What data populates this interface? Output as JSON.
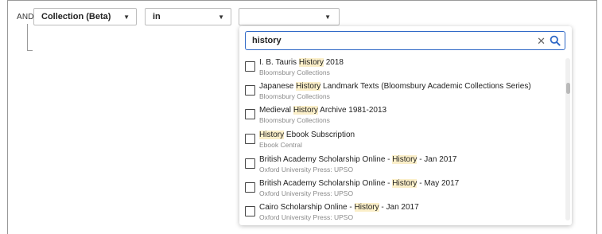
{
  "filter": {
    "conjunction": "AND",
    "field_select": "Collection (Beta)",
    "operator_select": "in",
    "value_select": ""
  },
  "search": {
    "value": "history"
  },
  "options": [
    {
      "pre": "I. B. Tauris ",
      "match": "History",
      "post": " 2018",
      "sub": "Bloomsbury Collections"
    },
    {
      "pre": "Japanese ",
      "match": "History",
      "post": " Landmark Texts (Bloomsbury Academic Collections Series)",
      "sub": "Bloomsbury Collections"
    },
    {
      "pre": "Medieval ",
      "match": "History",
      "post": " Archive 1981-2013",
      "sub": "Bloomsbury Collections"
    },
    {
      "pre": "",
      "match": "History",
      "post": " Ebook Subscription",
      "sub": "Ebook Central"
    },
    {
      "pre": "British Academy Scholarship Online - ",
      "match": "History",
      "post": " - Jan 2017",
      "sub": "Oxford University Press: UPSO"
    },
    {
      "pre": "British Academy Scholarship Online - ",
      "match": "History",
      "post": " - May 2017",
      "sub": "Oxford University Press: UPSO"
    },
    {
      "pre": "Cairo Scholarship Online - ",
      "match": "History",
      "post": " - Jan 2017",
      "sub": "Oxford University Press: UPSO"
    }
  ],
  "icons": {
    "caret": "caret-down-icon",
    "clear": "clear-icon",
    "search": "search-icon"
  },
  "colors": {
    "accent": "#2f68c6",
    "highlight": "#fbefc9",
    "muted_text": "#8a8a8a"
  }
}
